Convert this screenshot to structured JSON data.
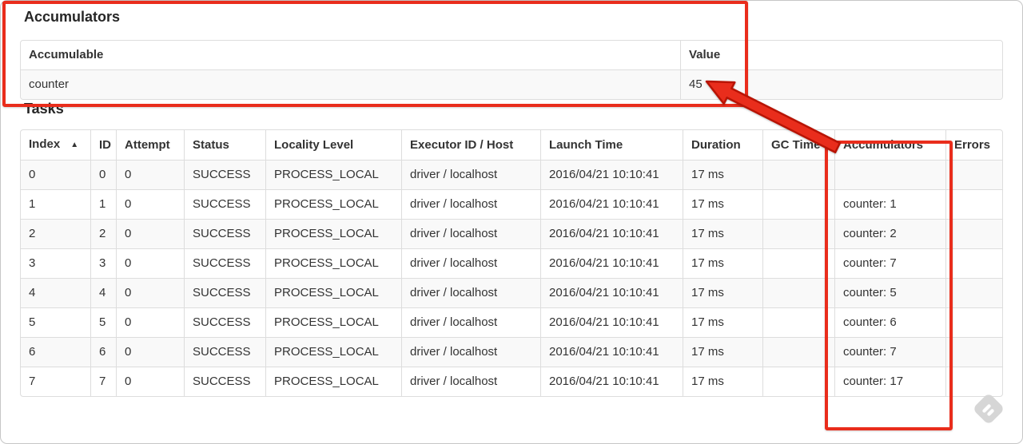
{
  "annotation": {
    "color": "#e92d1c",
    "outline_color": "#b81405"
  },
  "watermark": {
    "icon": "feedly-watermark-icon",
    "color": "#d6d6d6"
  },
  "accumulators_section": {
    "title": "Accumulators",
    "table": {
      "headers": [
        "Accumulable",
        "Value"
      ],
      "rows": [
        [
          "counter",
          "45"
        ]
      ]
    }
  },
  "tasks_section": {
    "title": "Tasks",
    "table": {
      "headers": [
        "Index",
        "ID",
        "Attempt",
        "Status",
        "Locality Level",
        "Executor ID / Host",
        "Launch Time",
        "Duration",
        "GC Time",
        "Accumulators",
        "Errors"
      ],
      "sort": {
        "column": 0,
        "indicator": "▲",
        "direction": "ascending"
      },
      "rows": [
        [
          "0",
          "0",
          "0",
          "SUCCESS",
          "PROCESS_LOCAL",
          "driver / localhost",
          "2016/04/21 10:10:41",
          "17 ms",
          "",
          "",
          ""
        ],
        [
          "1",
          "1",
          "0",
          "SUCCESS",
          "PROCESS_LOCAL",
          "driver / localhost",
          "2016/04/21 10:10:41",
          "17 ms",
          "",
          "counter: 1",
          ""
        ],
        [
          "2",
          "2",
          "0",
          "SUCCESS",
          "PROCESS_LOCAL",
          "driver / localhost",
          "2016/04/21 10:10:41",
          "17 ms",
          "",
          "counter: 2",
          ""
        ],
        [
          "3",
          "3",
          "0",
          "SUCCESS",
          "PROCESS_LOCAL",
          "driver / localhost",
          "2016/04/21 10:10:41",
          "17 ms",
          "",
          "counter: 7",
          ""
        ],
        [
          "4",
          "4",
          "0",
          "SUCCESS",
          "PROCESS_LOCAL",
          "driver / localhost",
          "2016/04/21 10:10:41",
          "17 ms",
          "",
          "counter: 5",
          ""
        ],
        [
          "5",
          "5",
          "0",
          "SUCCESS",
          "PROCESS_LOCAL",
          "driver / localhost",
          "2016/04/21 10:10:41",
          "17 ms",
          "",
          "counter: 6",
          ""
        ],
        [
          "6",
          "6",
          "0",
          "SUCCESS",
          "PROCESS_LOCAL",
          "driver / localhost",
          "2016/04/21 10:10:41",
          "17 ms",
          "",
          "counter: 7",
          ""
        ],
        [
          "7",
          "7",
          "0",
          "SUCCESS",
          "PROCESS_LOCAL",
          "driver / localhost",
          "2016/04/21 10:10:41",
          "17 ms",
          "",
          "counter: 17",
          ""
        ]
      ]
    }
  }
}
